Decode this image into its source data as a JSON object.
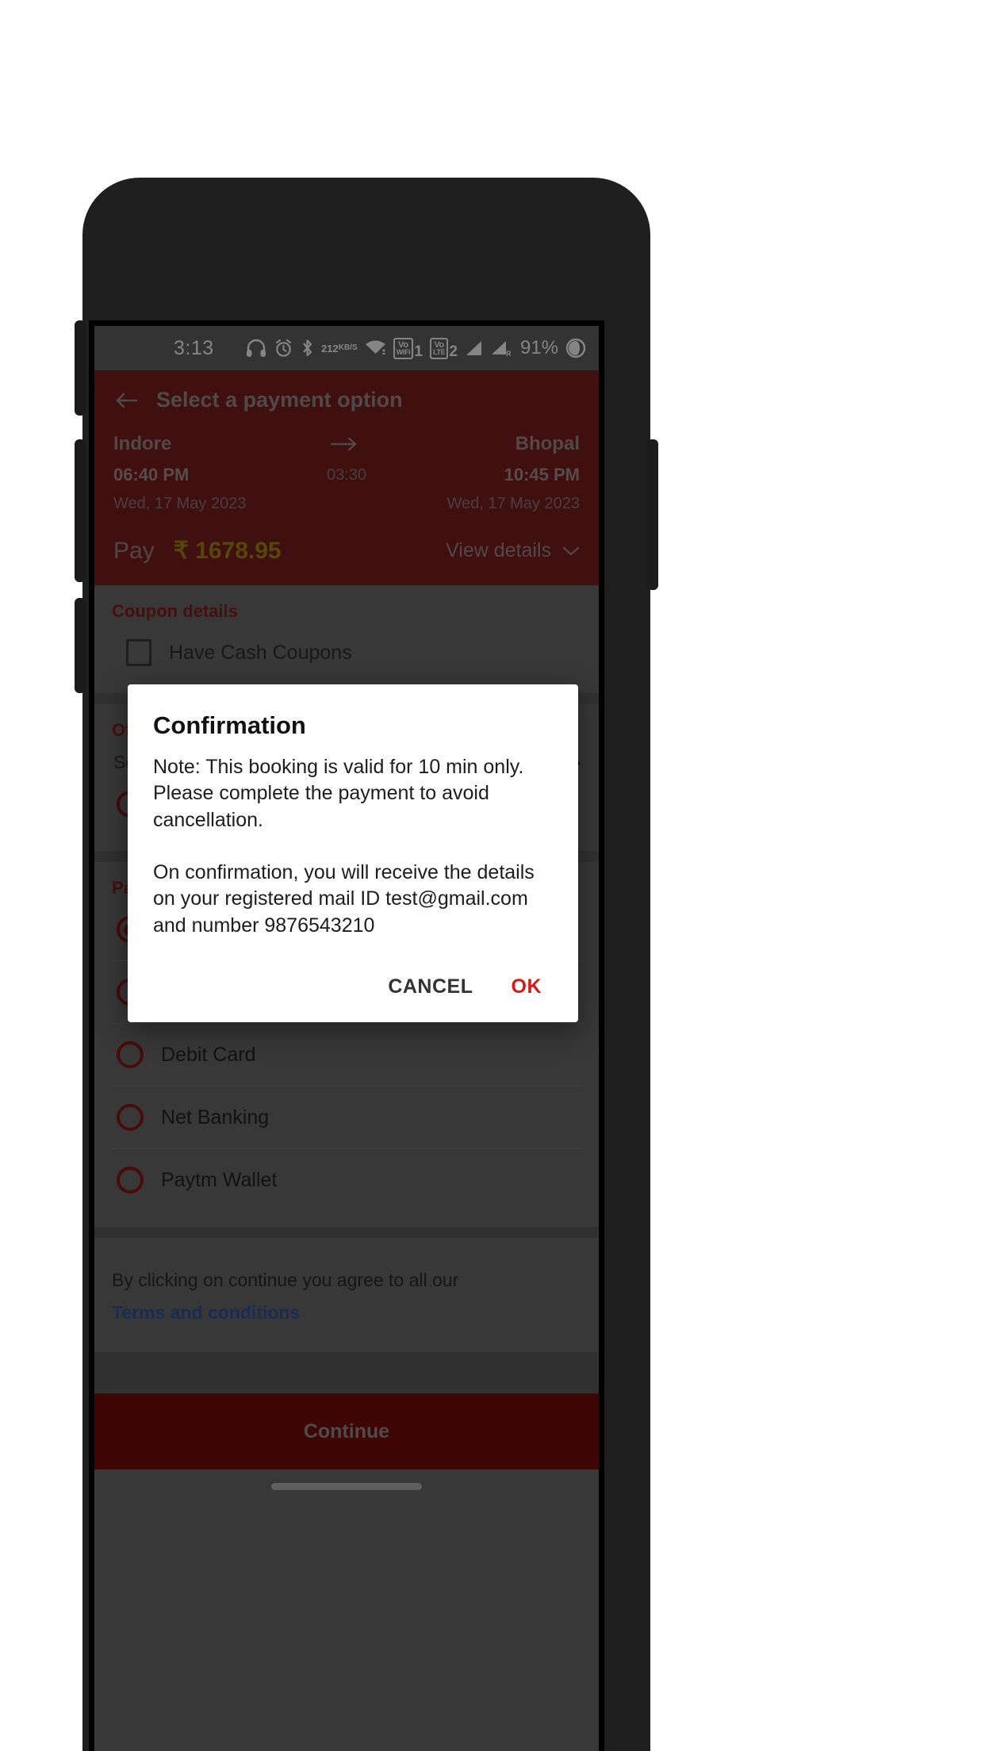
{
  "status_bar": {
    "time": "3:13",
    "data_rate": "212",
    "data_rate_unit": "KB/S",
    "volte_wifi_label": "Vo",
    "volte_wifi_sub": "WiFi",
    "volte_wifi_num": "1",
    "volte_label": "Vo",
    "volte_sub": "LTE",
    "volte_num": "2",
    "roaming_mark": "R",
    "battery": "91%",
    "icons": [
      "headset-icon",
      "alarm-icon",
      "bluetooth-icon",
      "data-rate-icon",
      "wifi-icon",
      "volte-wifi-icon",
      "volte-icon",
      "signal-1-icon",
      "signal-2-roaming-icon",
      "battery-icon"
    ]
  },
  "header": {
    "title": "Select a payment option",
    "back_icon": "back-arrow-icon"
  },
  "journey": {
    "from_city": "Indore",
    "to_city": "Bhopal",
    "depart_time": "06:40 PM",
    "duration": "03:30",
    "arrive_time": "10:45 PM",
    "depart_date": "Wed, 17 May 2023",
    "arrive_date": "Wed, 17 May 2023",
    "arrow_icon": "right-arrow-icon"
  },
  "pay": {
    "label": "Pay",
    "currency": "₹",
    "amount": "1678.95",
    "view_details": "View details",
    "chevron_icon": "chevron-down-icon",
    "amount_color": "#a2890f"
  },
  "coupon": {
    "section_title": "Coupon details",
    "checkbox_label": "Have Cash Coupons",
    "checked": false
  },
  "offer": {
    "section_title": "Offer type",
    "selected_text": "Select offer type",
    "chevron_icon": "chevron-up-icon",
    "options": [
      {
        "label": "",
        "selected": false
      }
    ]
  },
  "payment": {
    "section_title": "Payment options",
    "options": [
      {
        "label": "",
        "selected": true
      },
      {
        "label": "",
        "selected": false
      },
      {
        "label": "Debit Card",
        "selected": false
      },
      {
        "label": "Net Banking",
        "selected": false
      },
      {
        "label": "Paytm Wallet",
        "selected": false
      }
    ]
  },
  "terms": {
    "text": "By clicking on continue you agree to all our",
    "link": "Terms and conditions",
    "link_color": "#2f55a4"
  },
  "footer": {
    "continue_label": "Continue"
  },
  "dialog": {
    "title": "Confirmation",
    "body": "Note: This booking is valid for 10 min only. Please complete the payment to avoid cancellation.\n\nOn confirmation, you will receive the details on your registered mail ID test@gmail.com and number 9876543210",
    "cancel_label": "CANCEL",
    "ok_label": "OK",
    "ok_color": "#d61a1a"
  },
  "theme": {
    "brand_maroon": "#7b1d20",
    "accent_red": "#8b1c1c",
    "button_maroon": "#7a0d0d"
  }
}
